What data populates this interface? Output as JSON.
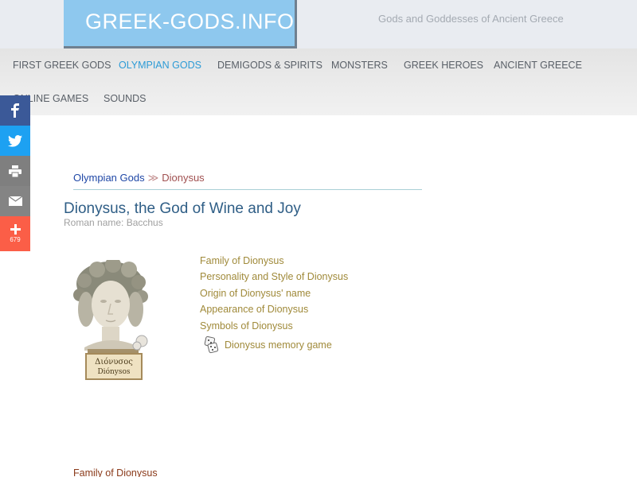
{
  "header": {
    "logo_text": "GREEK-GODS.INFO",
    "tagline": "Gods and Goddesses of Ancient Greece"
  },
  "nav": {
    "items": [
      {
        "label": "First Greek Gods",
        "active": false
      },
      {
        "label": "Olympian Gods",
        "active": true
      },
      {
        "label": "Demigods & Spirits",
        "active": false
      },
      {
        "label": "Monsters",
        "active": false
      },
      {
        "label": "Greek Heroes",
        "active": false
      },
      {
        "label": "Ancient Greece",
        "active": false
      },
      {
        "label": "Online Games",
        "active": false
      },
      {
        "label": "Sounds",
        "active": false
      }
    ]
  },
  "share": {
    "buttons": [
      "facebook-icon",
      "twitter-icon",
      "print-icon",
      "email-icon",
      "plus-icon"
    ],
    "count": "679"
  },
  "breadcrumb": {
    "parent": "Olympian Gods",
    "separator": "≫",
    "current": "Dionysus"
  },
  "article": {
    "title": "Dionysus, the God of Wine and Joy",
    "subtitle": "Roman name: Bacchus",
    "statue_caption_greek": "Διόνυσος",
    "statue_caption_latin": "Diónysos",
    "toc": [
      "Family of Dionysus",
      "Personality and Style of Dionysus",
      "Origin of Dionysus' name",
      "Appearance of Dionysus",
      "Symbols of Dionysus"
    ],
    "game_link": "Dionysus memory game",
    "section_heading": "Family of Dionysus"
  },
  "colors": {
    "logo_bg": "#8ec8ee",
    "nav_active": "#2d9bd6",
    "toc_link": "#a08a3a",
    "title": "#2f5e86"
  }
}
